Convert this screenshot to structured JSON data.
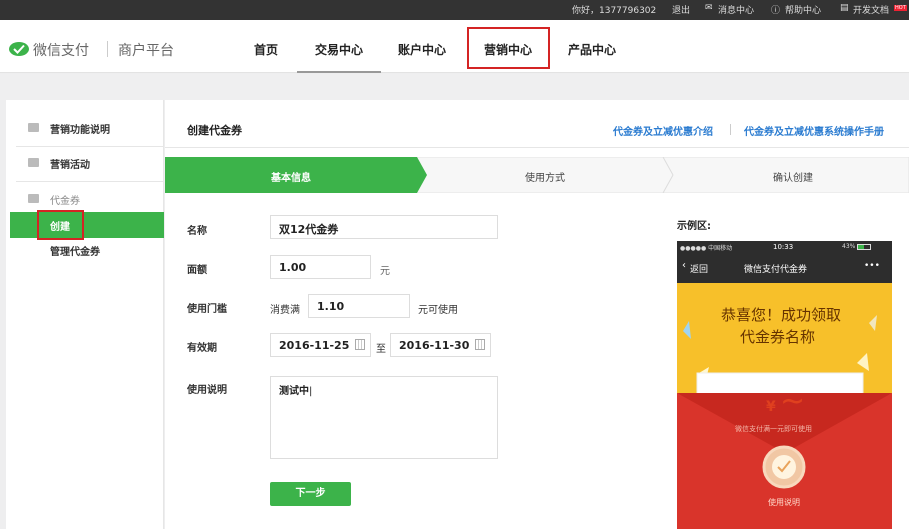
{
  "topbar": {
    "greeting": "你好，1377796302",
    "logout": "退出",
    "messages": "消息中心",
    "help": "帮助中心",
    "dev_docs": "开发文档",
    "hot_badge": "HOT"
  },
  "header": {
    "brand": "微信支付",
    "platform": "商户平台",
    "nav": [
      "首页",
      "交易中心",
      "账户中心",
      "营销中心",
      "产品中心"
    ]
  },
  "sidebar": {
    "intro": "营销功能说明",
    "activities": "营销活动",
    "coupons_group": "代金券",
    "create": "创建",
    "manage": "管理代金券"
  },
  "main": {
    "title": "创建代金券",
    "links": [
      "代金券及立减优惠介绍",
      "代金券及立减优惠系统操作手册"
    ],
    "steps": [
      "基本信息",
      "使用方式",
      "确认创建"
    ],
    "form": {
      "name_label": "名称",
      "name_value": "双12代金券",
      "amount_label": "面额",
      "amount_value": "1.00",
      "amount_unit": "元",
      "threshold_label": "使用门槛",
      "threshold_prefix": "消费满",
      "threshold_value": "1.10",
      "threshold_suffix": "元可使用",
      "validity_label": "有效期",
      "date_start": "2016-11-25",
      "date_to": "至",
      "date_end": "2016-11-30",
      "desc_label": "使用说明",
      "desc_value": "测试中",
      "next_button": "下一步"
    },
    "preview": {
      "label": "示例区:",
      "status_carrier": "●●●●● 中国移动",
      "status_time": "10:33",
      "status_battery": "43%",
      "back": "返回",
      "app_title": "微信支付代金券",
      "more": "•••",
      "congrats_line1": "恭喜您！成功领取",
      "congrats_line2": "代金券名称",
      "yen": "¥",
      "amount_placeholder": "~",
      "card_subtext": "微信支付满一元即可使用",
      "use_instructions": "使用说明"
    }
  },
  "colors": {
    "green": "#3cb34a",
    "highlight_red": "#d42424",
    "link_blue": "#2a7bd0",
    "envelope_red": "#d9342b",
    "preview_yellow": "#f7c02a"
  }
}
